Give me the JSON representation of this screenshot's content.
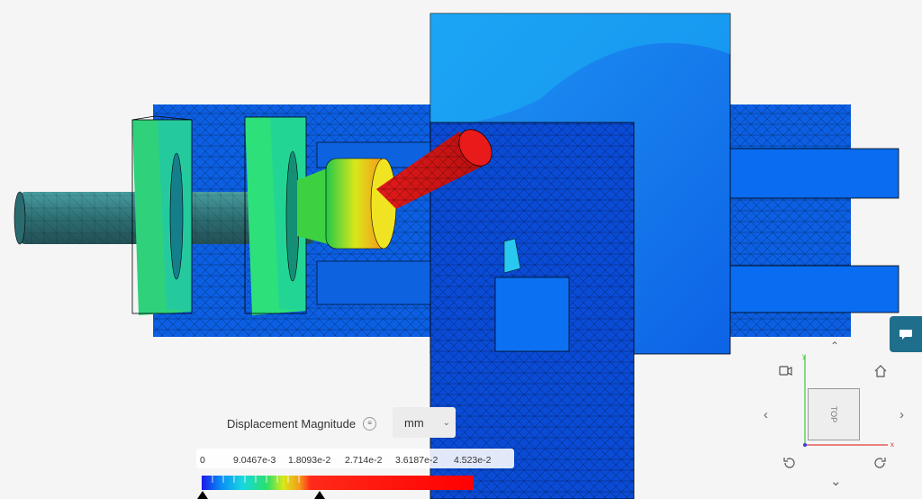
{
  "legend": {
    "title": "Displacement Magnitude",
    "unit": "mm",
    "ticks": [
      "0",
      "9.0467e-3",
      "1.8093e-2",
      "2.714e-2",
      "3.6187e-2",
      "4.523e-2"
    ]
  },
  "view_cube": {
    "face_label": "TOP",
    "axis_x": "x",
    "axis_y": "y"
  },
  "icons": {
    "chat": "chat-icon",
    "camera": "camera-icon",
    "home": "home-icon",
    "rotate_left": "rotate-ccw-icon",
    "rotate_right": "rotate-cw-icon"
  },
  "colors": {
    "accent": "#1f6e8c",
    "background": "#f5f5f5",
    "mesh_blue": "#0a6cf0",
    "max_red": "#ff0000"
  }
}
